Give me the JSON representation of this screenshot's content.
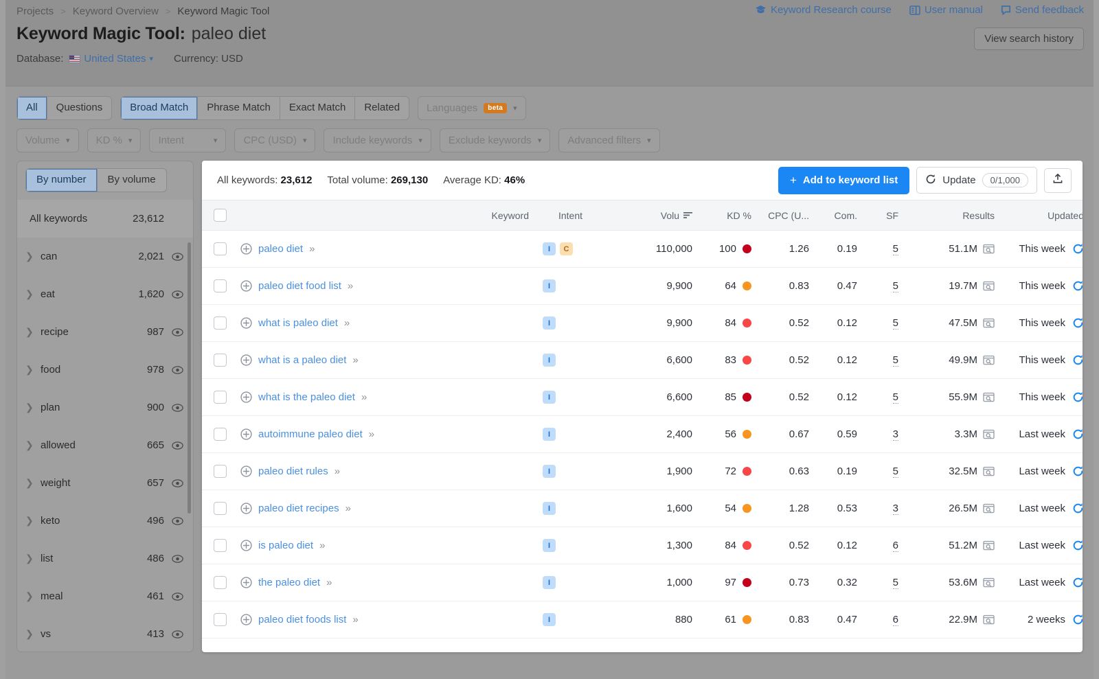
{
  "breadcrumb": {
    "items": [
      "Projects",
      "Keyword Overview",
      "Keyword Magic Tool"
    ],
    "separator": ">"
  },
  "header": {
    "title_prefix": "Keyword Magic Tool:",
    "title_query": "paleo diet",
    "database_label": "Database:",
    "database_value": "United States",
    "currency_label": "Currency: USD",
    "view_search_history": "View search history",
    "links": [
      {
        "label": "Keyword Research course",
        "icon": "graduation-cap-icon"
      },
      {
        "label": "User manual",
        "icon": "book-icon"
      },
      {
        "label": "Send feedback",
        "icon": "speech-bubble-icon"
      }
    ]
  },
  "filters": {
    "match_group_1": [
      {
        "label": "All",
        "active": true
      },
      {
        "label": "Questions",
        "active": false
      }
    ],
    "match_group_2": [
      {
        "label": "Broad Match",
        "active": true
      },
      {
        "label": "Phrase Match",
        "active": false
      },
      {
        "label": "Exact Match",
        "active": false
      },
      {
        "label": "Related",
        "active": false
      }
    ],
    "languages": {
      "label": "Languages",
      "badge": "beta"
    },
    "dropdowns": [
      "Volume",
      "KD %",
      "Intent",
      "CPC (USD)",
      "Include keywords",
      "Exclude keywords",
      "Advanced filters"
    ]
  },
  "sidebar": {
    "toggle": [
      {
        "label": "By number",
        "active": true
      },
      {
        "label": "By volume",
        "active": false
      }
    ],
    "all_keywords": {
      "label": "All keywords",
      "count": "23,612"
    },
    "groups": [
      {
        "label": "can",
        "count": "2,021"
      },
      {
        "label": "eat",
        "count": "1,620"
      },
      {
        "label": "recipe",
        "count": "987"
      },
      {
        "label": "food",
        "count": "978"
      },
      {
        "label": "plan",
        "count": "900"
      },
      {
        "label": "allowed",
        "count": "665"
      },
      {
        "label": "weight",
        "count": "657"
      },
      {
        "label": "keto",
        "count": "496"
      },
      {
        "label": "list",
        "count": "486"
      },
      {
        "label": "meal",
        "count": "461"
      },
      {
        "label": "vs",
        "count": "413"
      }
    ]
  },
  "panel": {
    "stats": {
      "all_keywords_label": "All keywords:",
      "all_keywords_value": "23,612",
      "total_volume_label": "Total volume:",
      "total_volume_value": "269,130",
      "average_kd_label": "Average KD:",
      "average_kd_value": "46%"
    },
    "add_to_list": "Add to keyword list",
    "update_label": "Update",
    "update_counter": "0/1,000",
    "export_icon": "export-upload-icon"
  },
  "table": {
    "columns": {
      "keyword": "Keyword",
      "intent": "Intent",
      "volume": "Volu",
      "kd": "KD %",
      "cpc": "CPC (U...",
      "com": "Com.",
      "sf": "SF",
      "results": "Results",
      "updated": "Updated"
    },
    "sorted_by": "volume",
    "rows": [
      {
        "keyword": "paleo diet",
        "intent": [
          "I",
          "C"
        ],
        "volume": "110,000",
        "kd": "100",
        "kd_color": "#c4001d",
        "cpc": "1.26",
        "com": "0.19",
        "sf": "5",
        "results": "51.1M",
        "updated": "This week"
      },
      {
        "keyword": "paleo diet food list",
        "intent": [
          "I"
        ],
        "volume": "9,900",
        "kd": "64",
        "kd_color": "#f79520",
        "cpc": "0.83",
        "com": "0.47",
        "sf": "5",
        "results": "19.7M",
        "updated": "This week"
      },
      {
        "keyword": "what is paleo diet",
        "intent": [
          "I"
        ],
        "volume": "9,900",
        "kd": "84",
        "kd_color": "#f94646",
        "cpc": "0.52",
        "com": "0.12",
        "sf": "5",
        "results": "47.5M",
        "updated": "This week"
      },
      {
        "keyword": "what is a paleo diet",
        "intent": [
          "I"
        ],
        "volume": "6,600",
        "kd": "83",
        "kd_color": "#f94646",
        "cpc": "0.52",
        "com": "0.12",
        "sf": "5",
        "results": "49.9M",
        "updated": "This week"
      },
      {
        "keyword": "what is the paleo diet",
        "intent": [
          "I"
        ],
        "volume": "6,600",
        "kd": "85",
        "kd_color": "#c4001d",
        "cpc": "0.52",
        "com": "0.12",
        "sf": "5",
        "results": "55.9M",
        "updated": "This week"
      },
      {
        "keyword": "autoimmune paleo diet",
        "intent": [
          "I"
        ],
        "volume": "2,400",
        "kd": "56",
        "kd_color": "#f79520",
        "cpc": "0.67",
        "com": "0.59",
        "sf": "3",
        "results": "3.3M",
        "updated": "Last week"
      },
      {
        "keyword": "paleo diet rules",
        "intent": [
          "I"
        ],
        "volume": "1,900",
        "kd": "72",
        "kd_color": "#f94646",
        "cpc": "0.63",
        "com": "0.19",
        "sf": "5",
        "results": "32.5M",
        "updated": "Last week"
      },
      {
        "keyword": "paleo diet recipes",
        "intent": [
          "I"
        ],
        "volume": "1,600",
        "kd": "54",
        "kd_color": "#f79520",
        "cpc": "1.28",
        "com": "0.53",
        "sf": "3",
        "results": "26.5M",
        "updated": "Last week"
      },
      {
        "keyword": "is paleo diet",
        "intent": [
          "I"
        ],
        "volume": "1,300",
        "kd": "84",
        "kd_color": "#f94646",
        "cpc": "0.52",
        "com": "0.12",
        "sf": "6",
        "results": "51.2M",
        "updated": "Last week"
      },
      {
        "keyword": "the paleo diet",
        "intent": [
          "I"
        ],
        "volume": "1,000",
        "kd": "97",
        "kd_color": "#c4001d",
        "cpc": "0.73",
        "com": "0.32",
        "sf": "5",
        "results": "53.6M",
        "updated": "Last week"
      },
      {
        "keyword": "paleo diet foods list",
        "intent": [
          "I"
        ],
        "volume": "880",
        "kd": "61",
        "kd_color": "#f79520",
        "cpc": "0.83",
        "com": "0.47",
        "sf": "6",
        "results": "22.9M",
        "updated": "2 weeks"
      }
    ]
  },
  "colors": {
    "accent_blue": "#1a87f5",
    "link_blue": "#4a90e2",
    "beta_orange": "#d4791e",
    "kd_red": "#c4001d",
    "kd_orange": "#f79520"
  }
}
